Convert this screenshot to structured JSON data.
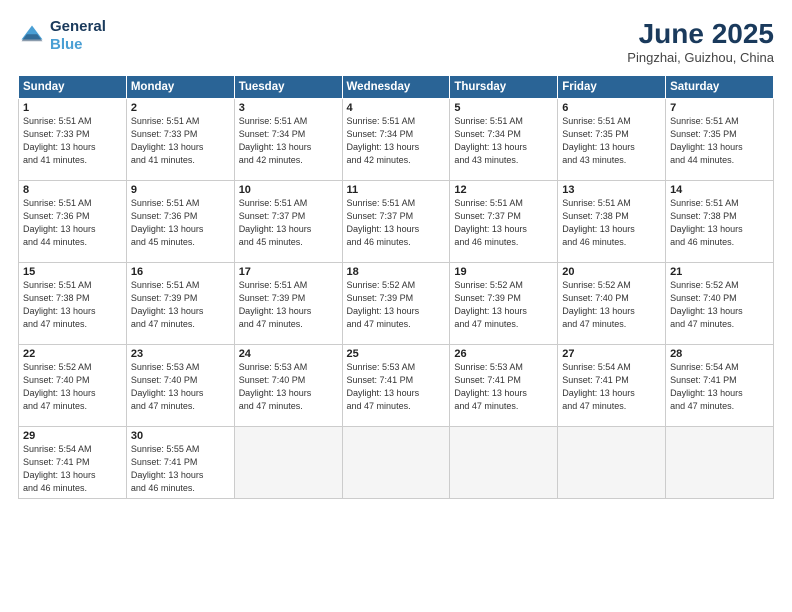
{
  "header": {
    "logo_line1": "General",
    "logo_line2": "Blue",
    "title": "June 2025",
    "subtitle": "Pingzhai, Guizhou, China"
  },
  "days_of_week": [
    "Sunday",
    "Monday",
    "Tuesday",
    "Wednesday",
    "Thursday",
    "Friday",
    "Saturday"
  ],
  "weeks": [
    [
      {
        "day": 1,
        "info": "Sunrise: 5:51 AM\nSunset: 7:33 PM\nDaylight: 13 hours\nand 41 minutes."
      },
      {
        "day": 2,
        "info": "Sunrise: 5:51 AM\nSunset: 7:33 PM\nDaylight: 13 hours\nand 41 minutes."
      },
      {
        "day": 3,
        "info": "Sunrise: 5:51 AM\nSunset: 7:34 PM\nDaylight: 13 hours\nand 42 minutes."
      },
      {
        "day": 4,
        "info": "Sunrise: 5:51 AM\nSunset: 7:34 PM\nDaylight: 13 hours\nand 42 minutes."
      },
      {
        "day": 5,
        "info": "Sunrise: 5:51 AM\nSunset: 7:34 PM\nDaylight: 13 hours\nand 43 minutes."
      },
      {
        "day": 6,
        "info": "Sunrise: 5:51 AM\nSunset: 7:35 PM\nDaylight: 13 hours\nand 43 minutes."
      },
      {
        "day": 7,
        "info": "Sunrise: 5:51 AM\nSunset: 7:35 PM\nDaylight: 13 hours\nand 44 minutes."
      }
    ],
    [
      {
        "day": 8,
        "info": "Sunrise: 5:51 AM\nSunset: 7:36 PM\nDaylight: 13 hours\nand 44 minutes."
      },
      {
        "day": 9,
        "info": "Sunrise: 5:51 AM\nSunset: 7:36 PM\nDaylight: 13 hours\nand 45 minutes."
      },
      {
        "day": 10,
        "info": "Sunrise: 5:51 AM\nSunset: 7:37 PM\nDaylight: 13 hours\nand 45 minutes."
      },
      {
        "day": 11,
        "info": "Sunrise: 5:51 AM\nSunset: 7:37 PM\nDaylight: 13 hours\nand 46 minutes."
      },
      {
        "day": 12,
        "info": "Sunrise: 5:51 AM\nSunset: 7:37 PM\nDaylight: 13 hours\nand 46 minutes."
      },
      {
        "day": 13,
        "info": "Sunrise: 5:51 AM\nSunset: 7:38 PM\nDaylight: 13 hours\nand 46 minutes."
      },
      {
        "day": 14,
        "info": "Sunrise: 5:51 AM\nSunset: 7:38 PM\nDaylight: 13 hours\nand 46 minutes."
      }
    ],
    [
      {
        "day": 15,
        "info": "Sunrise: 5:51 AM\nSunset: 7:38 PM\nDaylight: 13 hours\nand 47 minutes."
      },
      {
        "day": 16,
        "info": "Sunrise: 5:51 AM\nSunset: 7:39 PM\nDaylight: 13 hours\nand 47 minutes."
      },
      {
        "day": 17,
        "info": "Sunrise: 5:51 AM\nSunset: 7:39 PM\nDaylight: 13 hours\nand 47 minutes."
      },
      {
        "day": 18,
        "info": "Sunrise: 5:52 AM\nSunset: 7:39 PM\nDaylight: 13 hours\nand 47 minutes."
      },
      {
        "day": 19,
        "info": "Sunrise: 5:52 AM\nSunset: 7:39 PM\nDaylight: 13 hours\nand 47 minutes."
      },
      {
        "day": 20,
        "info": "Sunrise: 5:52 AM\nSunset: 7:40 PM\nDaylight: 13 hours\nand 47 minutes."
      },
      {
        "day": 21,
        "info": "Sunrise: 5:52 AM\nSunset: 7:40 PM\nDaylight: 13 hours\nand 47 minutes."
      }
    ],
    [
      {
        "day": 22,
        "info": "Sunrise: 5:52 AM\nSunset: 7:40 PM\nDaylight: 13 hours\nand 47 minutes."
      },
      {
        "day": 23,
        "info": "Sunrise: 5:53 AM\nSunset: 7:40 PM\nDaylight: 13 hours\nand 47 minutes."
      },
      {
        "day": 24,
        "info": "Sunrise: 5:53 AM\nSunset: 7:40 PM\nDaylight: 13 hours\nand 47 minutes."
      },
      {
        "day": 25,
        "info": "Sunrise: 5:53 AM\nSunset: 7:41 PM\nDaylight: 13 hours\nand 47 minutes."
      },
      {
        "day": 26,
        "info": "Sunrise: 5:53 AM\nSunset: 7:41 PM\nDaylight: 13 hours\nand 47 minutes."
      },
      {
        "day": 27,
        "info": "Sunrise: 5:54 AM\nSunset: 7:41 PM\nDaylight: 13 hours\nand 47 minutes."
      },
      {
        "day": 28,
        "info": "Sunrise: 5:54 AM\nSunset: 7:41 PM\nDaylight: 13 hours\nand 47 minutes."
      }
    ],
    [
      {
        "day": 29,
        "info": "Sunrise: 5:54 AM\nSunset: 7:41 PM\nDaylight: 13 hours\nand 46 minutes."
      },
      {
        "day": 30,
        "info": "Sunrise: 5:55 AM\nSunset: 7:41 PM\nDaylight: 13 hours\nand 46 minutes."
      },
      {
        "day": null,
        "info": ""
      },
      {
        "day": null,
        "info": ""
      },
      {
        "day": null,
        "info": ""
      },
      {
        "day": null,
        "info": ""
      },
      {
        "day": null,
        "info": ""
      }
    ]
  ]
}
